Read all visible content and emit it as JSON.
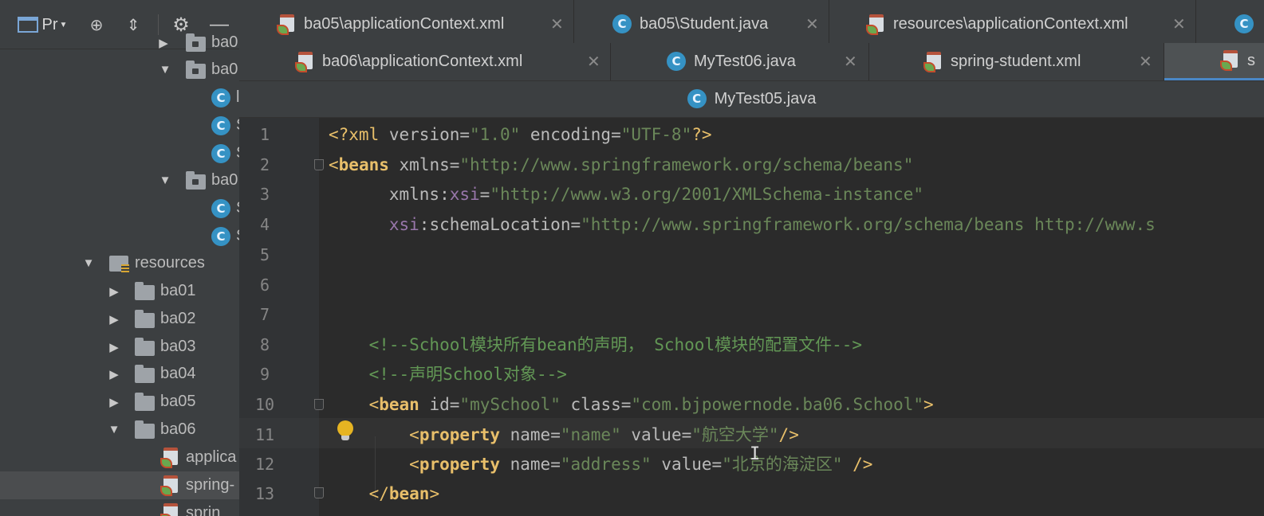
{
  "project_panel": {
    "toolbar": {
      "view_label": "Pr",
      "view_arrow": "▼",
      "target_icon": "⊕",
      "collapse_icon": "⇕",
      "gear_icon": "⚙",
      "hide_icon": "—"
    },
    "tree": [
      {
        "label": "ba0",
        "type": "package",
        "expanded": false
      },
      {
        "label": "ba0",
        "type": "package",
        "expanded": true
      },
      {
        "label": "l",
        "type": "class"
      },
      {
        "label": "S",
        "type": "class"
      },
      {
        "label": "S",
        "type": "class"
      },
      {
        "label": "ba0",
        "type": "package",
        "expanded": true
      },
      {
        "label": "S",
        "type": "class"
      },
      {
        "label": "S",
        "type": "class"
      },
      {
        "label": "resources",
        "type": "resources",
        "expanded": true
      },
      {
        "label": "ba01",
        "type": "folder",
        "expanded": false
      },
      {
        "label": "ba02",
        "type": "folder",
        "expanded": false
      },
      {
        "label": "ba03",
        "type": "folder",
        "expanded": false
      },
      {
        "label": "ba04",
        "type": "folder",
        "expanded": false
      },
      {
        "label": "ba05",
        "type": "folder",
        "expanded": false
      },
      {
        "label": "ba06",
        "type": "folder",
        "expanded": true
      },
      {
        "label": "applica",
        "type": "xml"
      },
      {
        "label": "spring-",
        "type": "xml",
        "selected": true
      },
      {
        "label": "sprin",
        "type": "xml"
      }
    ]
  },
  "tabs_row1": [
    {
      "label": "ba05\\applicationContext.xml",
      "icon": "xml-icon",
      "close": "✕"
    },
    {
      "label": "ba05\\Student.java",
      "icon": "class-icon",
      "close": "✕"
    },
    {
      "label": "resources\\applicationContext.xml",
      "icon": "xml-icon",
      "close": "✕"
    },
    {
      "label": "",
      "icon": "class-icon",
      "close": ""
    }
  ],
  "tabs_row2": [
    {
      "label": "ba06\\applicationContext.xml",
      "icon": "xml-icon",
      "close": "✕"
    },
    {
      "label": "MyTest06.java",
      "icon": "class-icon",
      "close": "✕"
    },
    {
      "label": "spring-student.xml",
      "icon": "xml-icon",
      "close": "✕"
    },
    {
      "label": "s",
      "icon": "xml-icon",
      "close": "",
      "active": true
    }
  ],
  "path_bar": {
    "label": "MyTest05.java",
    "icon": "class-icon"
  },
  "editor": {
    "line_numbers": [
      "1",
      "2",
      "3",
      "4",
      "5",
      "6",
      "7",
      "8",
      "9",
      "10",
      "11",
      "12",
      "13"
    ],
    "lines": {
      "l1": {
        "pi_open": "<?xml ",
        "a1": "version",
        "eq1": "=",
        "v1": "\"1.0\"",
        "sp": " ",
        "a2": "encoding",
        "eq2": "=",
        "v2": "\"UTF-8\"",
        "pi_close": "?>"
      },
      "l2": {
        "open": "<",
        "tag": "beans",
        "sp": " ",
        "attr": "xmlns",
        "eq": "=",
        "val": "\"http://www.springframework.org/schema/beans\""
      },
      "l3": {
        "indent": "      ",
        "attr": "xmlns",
        "colon": ":",
        "ns": "xsi",
        "eq": "=",
        "val": "\"http://www.w3.org/2001/XMLSchema-instance\""
      },
      "l4": {
        "indent": "      ",
        "ns": "xsi",
        "colon": ":",
        "attr": "schemaLocation",
        "eq": "=",
        "val": "\"http://www.springframework.org/schema/beans http://www.s"
      },
      "l8": {
        "indent": "    ",
        "text": "<!--School模块所有bean的声明， School模块的配置文件-->"
      },
      "l9": {
        "indent": "    ",
        "text": "<!--声明School对象-->"
      },
      "l10": {
        "indent": "    ",
        "open": "<",
        "tag": "bean",
        "sp1": " ",
        "a1": "id",
        "eq1": "=",
        "v1": "\"mySchool\"",
        "sp2": " ",
        "a2": "class",
        "eq2": "=",
        "v2": "\"com.bjpowernode.ba06.School\"",
        "close": ">"
      },
      "l11": {
        "indent": "        ",
        "open": "<",
        "tag": "property",
        "sp1": " ",
        "a1": "name",
        "eq1": "=",
        "v1": "\"name\"",
        "sp2": " ",
        "a2": "value",
        "eq2": "=",
        "v2": "\"航空大学\"",
        "close": "/>"
      },
      "l12": {
        "indent": "        ",
        "open": "<",
        "tag": "property",
        "sp1": " ",
        "a1": "name",
        "eq1": "=",
        "v1": "\"address\"",
        "sp2": " ",
        "a2": "value",
        "eq2": "=",
        "v2": "\"北京的海淀区\"",
        "close": " />"
      },
      "l13": {
        "indent": "    ",
        "open": "</",
        "tag": "bean",
        "close": ">"
      }
    },
    "cursor_glyph": "I"
  },
  "colors": {
    "tag": "#e8bf6a",
    "attr": "#bababa",
    "namespace": "#9876aa",
    "string": "#6a8759",
    "comment": "#629755",
    "background": "#2b2b2b",
    "panel": "#3c3f41",
    "class_icon": "#3592c4"
  }
}
